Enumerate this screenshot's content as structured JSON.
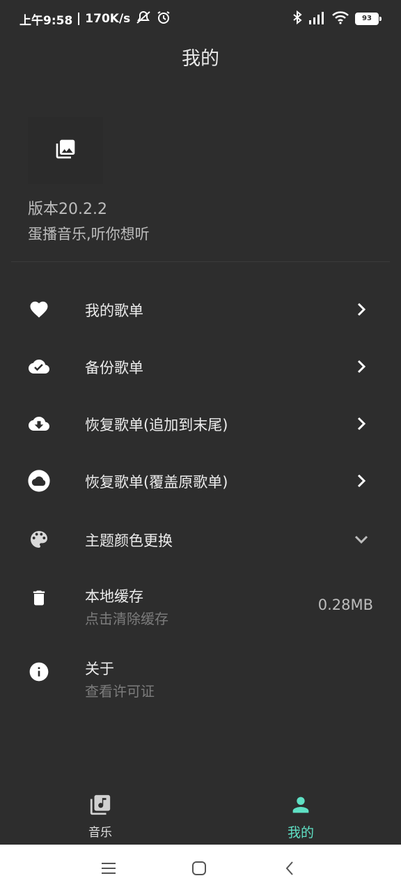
{
  "status_bar": {
    "time": "上午9:58",
    "speed": "170K/s",
    "battery": "93"
  },
  "header": {
    "title": "我的"
  },
  "profile": {
    "version": "版本20.2.2",
    "slogan": "蛋播音乐,听你想听"
  },
  "menu": {
    "items": [
      {
        "label": "我的歌单",
        "icon": "heart-icon"
      },
      {
        "label": "备份歌单",
        "icon": "cloud-check-icon"
      },
      {
        "label": "恢复歌单(追加到末尾)",
        "icon": "cloud-download-icon"
      },
      {
        "label": "恢复歌单(覆盖原歌单)",
        "icon": "cloud-icon"
      },
      {
        "label": "主题颜色更换",
        "icon": "palette-icon"
      },
      {
        "label": "本地缓存",
        "sub": "点击清除缓存",
        "value": "0.28MB",
        "icon": "trash-icon"
      },
      {
        "label": "关于",
        "sub": "查看许可证",
        "icon": "info-icon"
      }
    ]
  },
  "bottom_nav": {
    "tabs": [
      {
        "label": "音乐",
        "icon": "music-library-icon",
        "active": false
      },
      {
        "label": "我的",
        "icon": "person-icon",
        "active": true
      }
    ]
  },
  "colors": {
    "background": "#2d2d2d",
    "accent": "#5fe0c4",
    "text": "#ececec",
    "muted": "#7c7c7c"
  }
}
